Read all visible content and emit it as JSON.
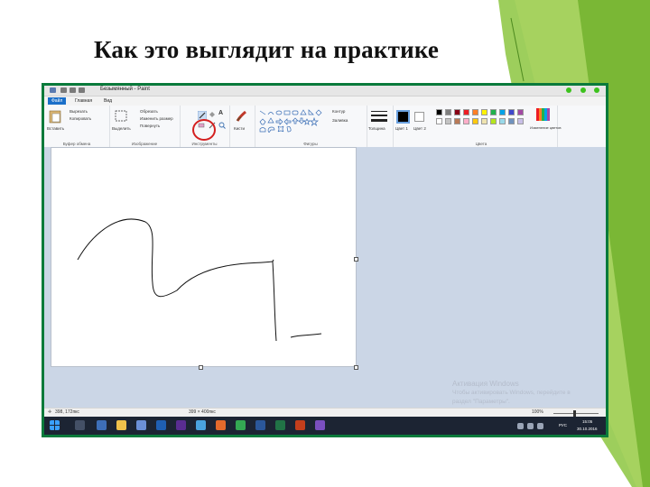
{
  "slide": {
    "title": "Как это выглядит на практике"
  },
  "window": {
    "doc_title": "Безымянный - Paint"
  },
  "ribbon_tabs": [
    {
      "label": "Файл"
    },
    {
      "label": "Главная"
    },
    {
      "label": "Вид"
    }
  ],
  "ribbon": {
    "paste_label": "Вставить",
    "cut_label": "Вырезать",
    "copy_label": "Копировать",
    "clipboard_group": "Буфер обмена",
    "select_label": "Выделить",
    "crop_label": "Обрезать",
    "resize_label": "Изменить размер",
    "rotate_label": "Повернуть",
    "image_group": "Изображение",
    "tools_group": "Инструменты",
    "brushes_label": "Кисти",
    "contour_label": "Контур",
    "fill_label": "Заливка",
    "shapes_group": "Фигуры",
    "size_label": "Толщина",
    "color1_label": "Цвет 1",
    "color2_label": "Цвет 2",
    "colors_group": "Цвета",
    "edit_colors_label": "Изменение цветов"
  },
  "palette": {
    "row1": [
      "#000000",
      "#7f7f7f",
      "#880015",
      "#ed1c24",
      "#ff7f27",
      "#fff200",
      "#22b14c",
      "#00a2e8",
      "#3f48cc",
      "#a349a4"
    ],
    "row2": [
      "#ffffff",
      "#c3c3c3",
      "#b97a57",
      "#ffaec9",
      "#ffc90e",
      "#efe4b0",
      "#b5e61d",
      "#99d9ea",
      "#7092be",
      "#c8bfe7"
    ],
    "color1": "#000000",
    "color2": "#ffffff",
    "highlight_color": "#d42020",
    "window_border": "#0a7a3b"
  },
  "watermark": {
    "line1": "Активация Windows",
    "line2": "Чтобы активировать Windows, перейдите в",
    "line3": "раздел \"Параметры\"."
  },
  "status": {
    "cursor_pos": "398, 172пкс",
    "canvas_size": "399 × 400пкс",
    "zoom": "100%"
  },
  "taskbar": {
    "language": "РУС",
    "time": "15:05",
    "date": "30.10.2016"
  }
}
